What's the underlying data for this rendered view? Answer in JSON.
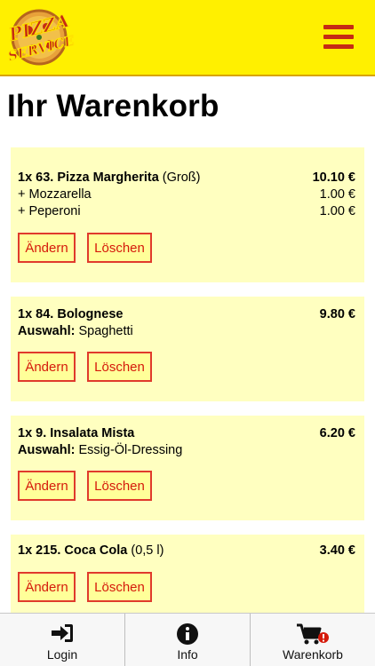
{
  "header": {
    "logo_text": "PIZZA SERVICE",
    "menu_icon": "hamburger-icon"
  },
  "page": {
    "title": "Ihr Warenkorb"
  },
  "cart": {
    "items": [
      {
        "title": "1x 63. Pizza Margherita",
        "variant": "(Groß)",
        "price": "10.10 €",
        "extras": [
          {
            "label": "+ Mozzarella",
            "price": "1.00 €"
          },
          {
            "label": "+ Peperoni",
            "price": "1.00 €"
          }
        ],
        "edit_label": "Ändern",
        "delete_label": "Löschen"
      },
      {
        "title": "1x 84. Bolognese",
        "price": "9.80 €",
        "choice_label": "Auswahl:",
        "choice_value": "Spaghetti",
        "edit_label": "Ändern",
        "delete_label": "Löschen"
      },
      {
        "title": "1x 9. Insalata Mista",
        "price": "6.20 €",
        "choice_label": "Auswahl:",
        "choice_value": "Essig-Öl-Dressing",
        "edit_label": "Ändern",
        "delete_label": "Löschen"
      },
      {
        "title": "1x 215. Coca Cola",
        "variant": "(0,5 l)",
        "price": "3.40 €",
        "edit_label": "Ändern",
        "delete_label": "Löschen"
      }
    ]
  },
  "tabbar": {
    "tabs": [
      {
        "label": "Login",
        "icon": "login-icon"
      },
      {
        "label": "Info",
        "icon": "info-icon"
      },
      {
        "label": "Warenkorb",
        "icon": "cart-icon"
      }
    ]
  },
  "colors": {
    "header_bg": "#fff000",
    "accent_red": "#c62b14",
    "item_bg": "#ffffc0"
  }
}
